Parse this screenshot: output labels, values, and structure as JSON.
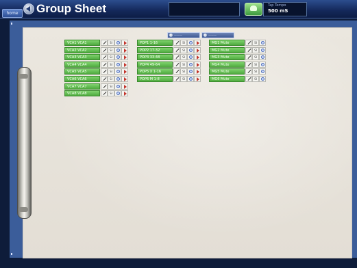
{
  "header": {
    "home_label": "home",
    "title": "Group Sheet",
    "tap_tempo_label": "Tap Tempo",
    "tap_tempo_value": "500 mS"
  },
  "sheet_tabs": [
    {
      "label": "———"
    },
    {
      "label": "———"
    }
  ],
  "group_columns": [
    {
      "items": [
        {
          "name": "VCA1 VCA1"
        },
        {
          "name": "VCA2 VCA2"
        },
        {
          "name": "VCA3 VCA3"
        },
        {
          "name": "VCA4 VCA4"
        },
        {
          "name": "VCA5 VCA5"
        },
        {
          "name": "VCA6 VCA6"
        },
        {
          "name": "VCA7 VCA7"
        },
        {
          "name": "VCA8 VCA8"
        }
      ]
    },
    {
      "items": [
        {
          "name": "POP1 1-16"
        },
        {
          "name": "POP2 17-32"
        },
        {
          "name": "POP3 33-48"
        },
        {
          "name": "POP4 49-64"
        },
        {
          "name": "POP5 X 1-16"
        },
        {
          "name": "POP6 M 1-8"
        }
      ]
    },
    {
      "items": [
        {
          "name": "MG1 Mute"
        },
        {
          "name": "MG2 Mute"
        },
        {
          "name": "MG3 Mute"
        },
        {
          "name": "MG4 Mute"
        },
        {
          "name": "MG5 Mute"
        },
        {
          "name": "MG6 Mute"
        }
      ]
    }
  ],
  "solo_label": "SI",
  "colors": {
    "group_green": "#5fbd4d",
    "frame_blue": "#3b5d9a",
    "panel_paper": "#e8e4dc"
  }
}
